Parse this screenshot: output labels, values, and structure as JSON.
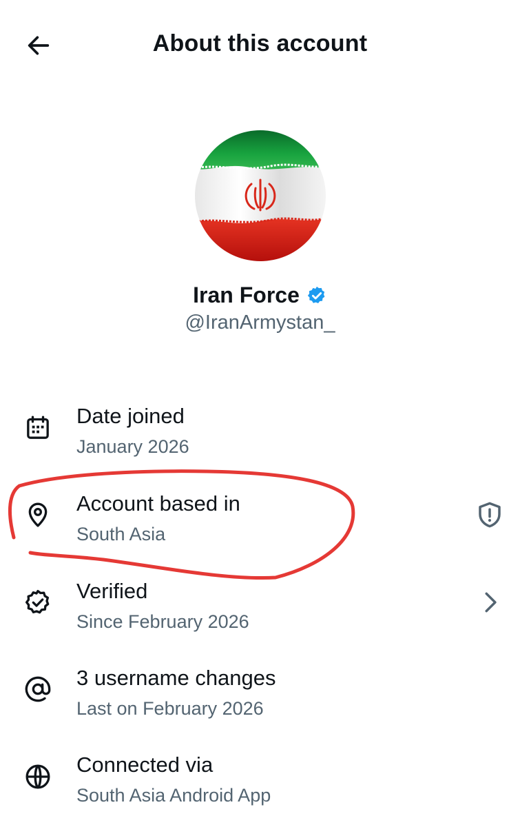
{
  "header": {
    "title": "About this account",
    "back_icon": "arrow-left-icon"
  },
  "profile": {
    "name": "Iran Force",
    "handle": "@IranArmystan_",
    "verified": true,
    "badge_color": "#1d9bf0",
    "avatar_image": "Iran flag (green, white, red with red emblem)"
  },
  "colors": {
    "text_primary": "#0f1419",
    "text_secondary": "#536471",
    "annotation_red": "#e53935"
  },
  "items": [
    {
      "icon": "calendar-icon",
      "label": "Date joined",
      "value": "January 2026"
    },
    {
      "icon": "location-pin-icon",
      "label": "Account based in",
      "value": "South Asia",
      "trailing_icon": "shield-alert-icon"
    },
    {
      "icon": "verified-check-icon",
      "label": "Verified",
      "value": "Since February 2026",
      "trailing_icon": "chevron-right-icon"
    },
    {
      "icon": "at-sign-icon",
      "label": "3 username changes",
      "value": "Last on February 2026"
    },
    {
      "icon": "globe-icon",
      "label": "Connected via",
      "value": "South Asia Android App"
    }
  ]
}
